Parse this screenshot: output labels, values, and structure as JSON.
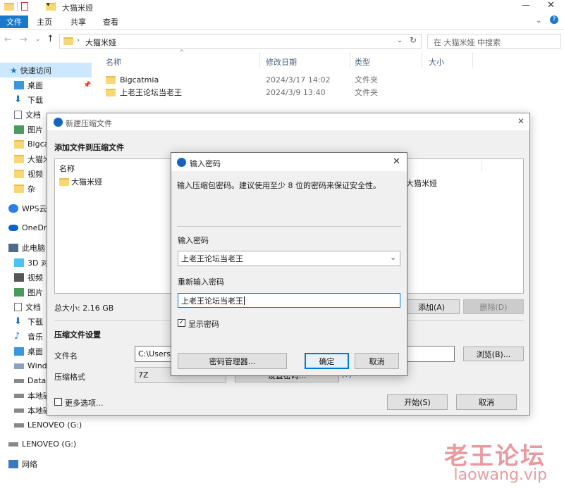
{
  "titlebar": {
    "title": "大猫米娅"
  },
  "ribbon": {
    "tabs": [
      "文件",
      "主页",
      "共享",
      "查看"
    ]
  },
  "address": {
    "path": "大猫米娅",
    "search_placeholder": "在 大猫米娅 中搜索"
  },
  "columns": {
    "name": "名称",
    "date": "修改日期",
    "type": "类型",
    "size": "大小"
  },
  "files": [
    {
      "name": "Bigcatmia",
      "date": "2024/3/17 14:02",
      "type": "文件夹"
    },
    {
      "name": "上老王论坛当老王",
      "date": "2024/3/9 13:40",
      "type": "文件夹"
    }
  ],
  "sidebar": {
    "items": [
      "快速访问",
      "桌面",
      "下载",
      "文档",
      "图片",
      "Bigca",
      "大猫米",
      "视频",
      "杂",
      "WPS云",
      "OneDri",
      "此电脑",
      "3D 对",
      "视频",
      "图片",
      "文档",
      "下载",
      "音乐",
      "桌面",
      "Windo",
      "Data",
      "本地磁",
      "本地磁",
      "LENOVEO (G:)",
      "LENOVEO (G:)",
      "网络"
    ]
  },
  "archive_dialog": {
    "title": "新建压缩文件",
    "section_add": "添加文件到压缩文件",
    "list_header_name": "名称",
    "list_item": "大猫米娅",
    "list_item_right": "大猫米娅",
    "total_size": "总大小: 2.16 GB",
    "add_button": "添加(A)",
    "delete_button": "删除(D)",
    "settings_title": "压缩文件设置",
    "filename_label": "文件名",
    "filename_value": "C:\\Users\\",
    "browse_button": "浏览(B)...",
    "format_label": "压缩格式",
    "format_value": "7Z",
    "set_button_partial": "设置密码...",
    "more_options": "更多选项...",
    "start_button": "开始(S)",
    "cancel_button": "取消"
  },
  "password_dialog": {
    "title": "输入密码",
    "description": "输入压缩包密码。建议使用至少 8 位的密码来保证安全性。",
    "password_label": "输入密码",
    "password_value": "上老王论坛当老王",
    "confirm_label": "重新输入密码",
    "confirm_value": "上老王论坛当老王",
    "show_password": "显示密码",
    "manager_button": "密码管理器...",
    "ok_button": "确定",
    "cancel_button": "取消"
  },
  "watermark": {
    "cn": "老王论坛",
    "en": "laowang.vip"
  },
  "colors": {
    "accent": "#0078d7",
    "watermark": "#e89aa0"
  }
}
